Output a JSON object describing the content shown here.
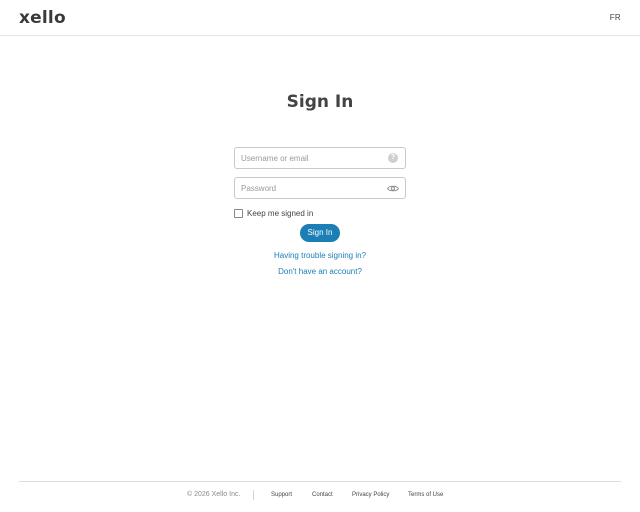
{
  "header": {
    "logo_text": "xello",
    "language_toggle": "FR"
  },
  "main": {
    "title": "Sign In",
    "username": {
      "placeholder": "Username or email",
      "value": "",
      "help_icon_glyph": "?"
    },
    "password": {
      "placeholder": "Password",
      "value": ""
    },
    "remember_label": "Keep me signed in",
    "remember_checked": false,
    "signin_button": "Sign In",
    "trouble_link": "Having trouble signing in?",
    "account_link": "Don't have an account?"
  },
  "footer": {
    "copyright": "© 2026 Xello Inc.",
    "links": [
      "Support",
      "Contact",
      "Privacy Policy",
      "Terms of Use"
    ]
  },
  "colors": {
    "accent": "#1b7fb6",
    "text": "#444444",
    "border": "#c9c9c9"
  },
  "icons": {
    "help": "question-circle-icon",
    "password_visibility": "eye-icon"
  }
}
